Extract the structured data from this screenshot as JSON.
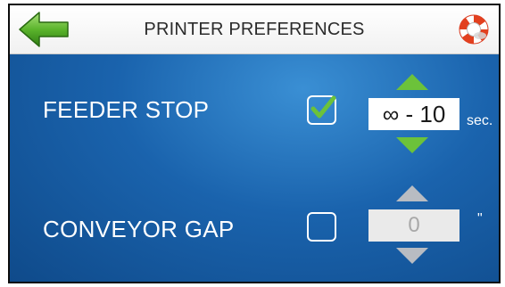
{
  "header": {
    "title": "PRINTER PREFERENCES",
    "back_icon": "back-arrow-icon",
    "help_icon": "life-ring-icon"
  },
  "colors": {
    "accent_green": "#6cc23a",
    "panel_blue": "#1a63ad",
    "disabled_gray": "#b8bcc2"
  },
  "rows": [
    {
      "label": "FEEDER STOP",
      "checked": true,
      "value": "∞ - 10",
      "unit": "sec.",
      "enabled": true
    },
    {
      "label": "CONVEYOR GAP",
      "checked": false,
      "value": "0",
      "unit": "\"",
      "enabled": false
    }
  ]
}
